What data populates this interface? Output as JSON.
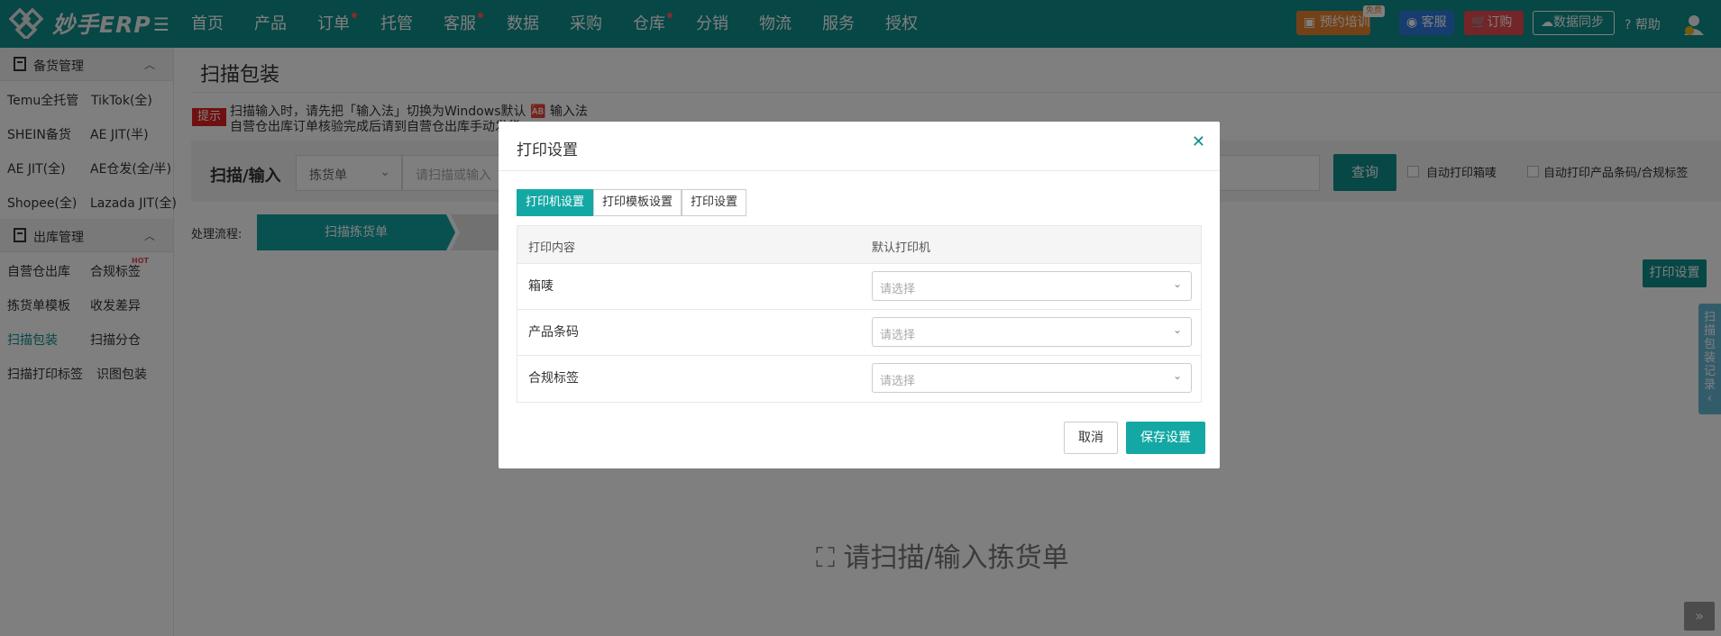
{
  "brand": {
    "logo_text": "妙手ERP"
  },
  "nav": {
    "items": [
      "首页",
      "产品",
      "订单",
      "托管",
      "客服",
      "数据",
      "采购",
      "仓库",
      "分销",
      "物流",
      "服务",
      "授权"
    ]
  },
  "toolbar": {
    "training": "预约培训",
    "free_tag": "免费",
    "service": "客服",
    "order": "订购",
    "sync": "数据同步",
    "help": "帮助"
  },
  "sidebar": {
    "groups": [
      {
        "title": "备货管理",
        "items": [
          "Temu全托管",
          "TikTok(全)",
          "SHEIN备货",
          "AE JIT(半)",
          "AE JIT(全)",
          "AE仓发(全/半)",
          "Shopee(全)",
          "Lazada JIT(全)"
        ]
      },
      {
        "title": "出库管理",
        "items": [
          "自营仓出库",
          "合规标签",
          "拣货单模板",
          "收发差异",
          "扫描包装",
          "扫描分仓",
          "扫描打印标签",
          "识图包装"
        ]
      }
    ],
    "hot_label": "HOT",
    "active_item": "扫描包装"
  },
  "page": {
    "title": "扫描包装",
    "tip_badge": "提示",
    "tip_line1": "扫描输入时，请先把「输入法」切换为Windows默认 🆎 输入法",
    "tip_line2": "自营仓出库订单核验完成后请到自营仓出库手动发货",
    "scan_label": "扫描/输入",
    "scan_select": "拣货单",
    "scan_placeholder": "请扫描或输入",
    "query_button": "查询",
    "auto_print_box": "自动打印箱唛",
    "auto_print_label": "自动打印产品条码/合规标签",
    "flow_label": "处理流程:",
    "flow_step1": "扫描拣货单",
    "print_settings_button": "打印设置",
    "side_tab": "扫描包装记录",
    "empty_hint": "请扫描/输入拣货单"
  },
  "modal": {
    "title": "打印设置",
    "tabs": [
      "打印机设置",
      "打印模板设置",
      "打印设置"
    ],
    "active_tab": 0,
    "columns": [
      "打印内容",
      "默认打印机"
    ],
    "rows": [
      {
        "label": "箱唛",
        "placeholder": "请选择"
      },
      {
        "label": "产品条码",
        "placeholder": "请选择"
      },
      {
        "label": "合规标签",
        "placeholder": "请选择"
      }
    ],
    "cancel": "取消",
    "save": "保存设置"
  },
  "colors": {
    "brand": "#0e8e8c",
    "accent": "#14a8a4",
    "danger": "#e84a4f"
  }
}
